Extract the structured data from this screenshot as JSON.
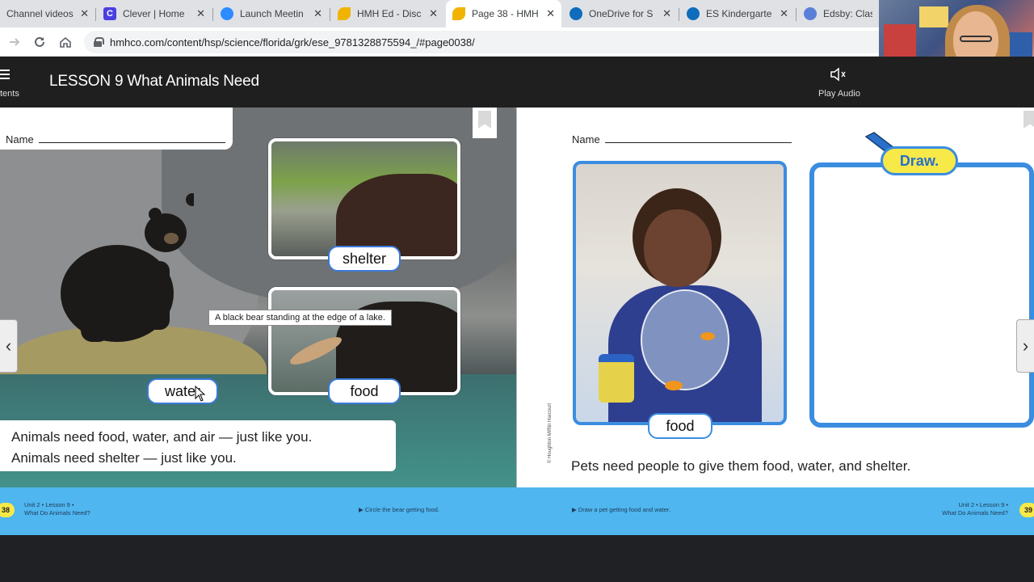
{
  "browser": {
    "tabs": [
      {
        "title": "Channel videos",
        "icon": "youtube-icon",
        "color": "#ff0000"
      },
      {
        "title": "Clever | Home",
        "icon": "clever-icon",
        "color": "#4a3fe0"
      },
      {
        "title": "Launch Meetin",
        "icon": "zoom-icon",
        "color": "#2d8cff"
      },
      {
        "title": "HMH Ed - Disc",
        "icon": "hmh-icon",
        "color": "#f0b400"
      },
      {
        "title": "Page 38 - HMH",
        "icon": "hmh-icon",
        "color": "#f0b400",
        "active": true
      },
      {
        "title": "OneDrive for S",
        "icon": "onedrive-icon",
        "color": "#0f6cbd"
      },
      {
        "title": "ES Kindergarte",
        "icon": "onedrive-icon",
        "color": "#0f6cbd"
      },
      {
        "title": "Edsby: Class",
        "icon": "edsby-icon",
        "color": "#5a7fd8"
      }
    ],
    "close_glyph": "✕",
    "url": "hmhco.com/content/hsp/science/florida/grk/ese_9781328875594_/#page0038/"
  },
  "reader": {
    "contents_label": "tents",
    "lesson_title": "LESSON 9 What Animals Need",
    "audio_label": "Play Audio"
  },
  "left_page": {
    "name_label": "Name",
    "labels": {
      "shelter": "shelter",
      "water": "water",
      "food": "food"
    },
    "tooltip": "A black bear standing at the edge of a lake.",
    "caption_line1": "Animals need food, water, and air — just like you.",
    "caption_line2": "Animals need shelter — just like you."
  },
  "right_page": {
    "name_label": "Name",
    "draw_badge": "Draw.",
    "food_label": "food",
    "caption": "Pets need people to give them food, water, and shelter."
  },
  "footer": {
    "left_page_num": "38",
    "right_page_num": "39",
    "left_unit_line1": "Unit 2 • Lesson 9 •",
    "left_unit_line2": "What Do Animals Need?",
    "right_unit_line1": "Unit 2 • Lesson 9 •",
    "right_unit_line2": "What Do Animals Need?",
    "left_instruction": "▶ Circle the bear getting food.",
    "right_instruction": "▶ Draw a pet getting food and water."
  },
  "nav": {
    "prev": "‹",
    "next": "›"
  }
}
